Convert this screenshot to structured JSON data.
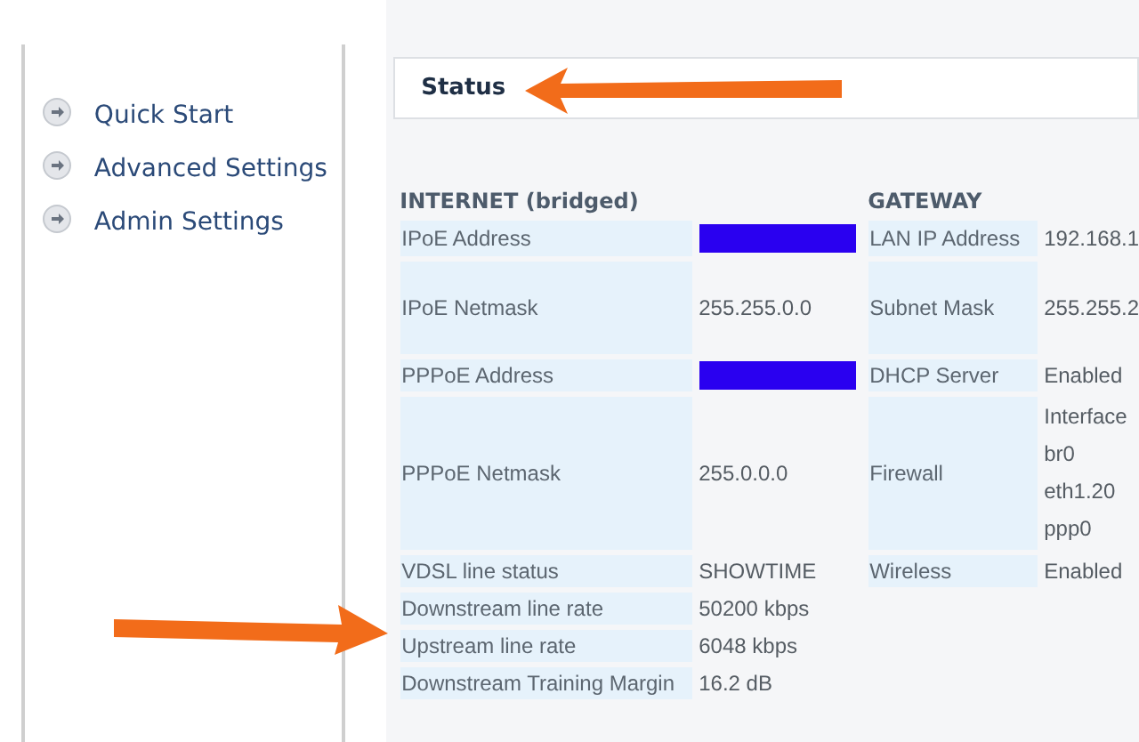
{
  "sidebar": {
    "items": [
      {
        "label": "Quick Start"
      },
      {
        "label": "Advanced Settings"
      },
      {
        "label": "Admin Settings"
      }
    ]
  },
  "status_panel": {
    "title": "Status"
  },
  "internet": {
    "title": "INTERNET (bridged)",
    "rows": [
      {
        "label": "IPoE Address",
        "kind": "redacted"
      },
      {
        "label": "IPoE Netmask",
        "kind": "text",
        "value": "255.255.0.0"
      },
      {
        "label": "PPPoE Address",
        "kind": "redacted"
      },
      {
        "label": "PPPoE Netmask",
        "kind": "text",
        "value": "255.0.0.0"
      },
      {
        "label": "VDSL line status",
        "kind": "text",
        "value": "SHOWTIME"
      },
      {
        "label": "Downstream line rate",
        "kind": "text",
        "value": "50200 kbps"
      },
      {
        "label": "Upstream line rate",
        "kind": "text",
        "value": "6048 kbps"
      },
      {
        "label": "Downstream Training Margin",
        "kind": "text",
        "value": "16.2 dB"
      }
    ]
  },
  "gateway": {
    "title": "GATEWAY",
    "rows": [
      {
        "label": "LAN IP Address",
        "kind": "text",
        "value": "192.168.1"
      },
      {
        "label": "Subnet Mask",
        "kind": "text",
        "value": "255.255.2"
      },
      {
        "label": "DHCP Server",
        "kind": "text",
        "value": "Enabled"
      },
      {
        "label": "Firewall",
        "kind": "list",
        "values": [
          "Interface",
          "br0",
          "eth1.20",
          "ppp0"
        ]
      },
      {
        "label": "Wireless",
        "kind": "text",
        "value": "Enabled"
      }
    ]
  }
}
